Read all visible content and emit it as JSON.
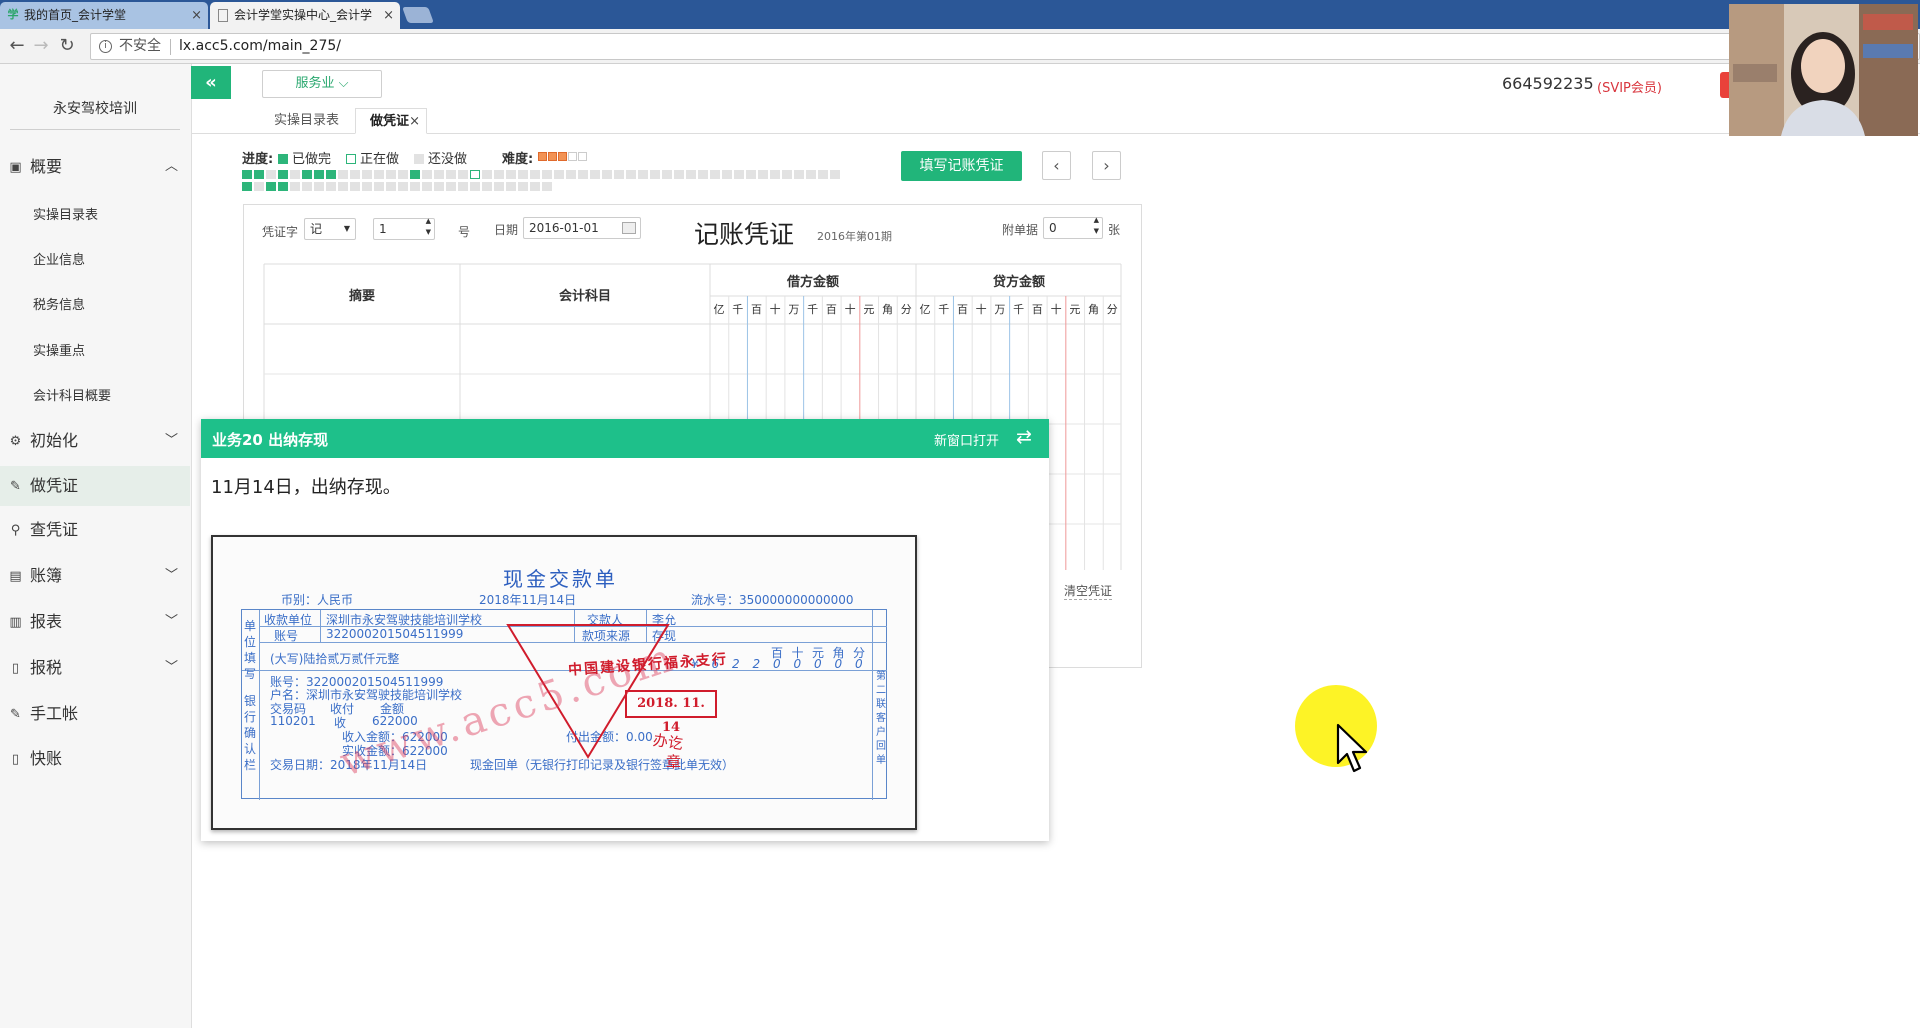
{
  "browser": {
    "tabs": [
      {
        "label": "我的首页_会计学堂",
        "close": "×"
      },
      {
        "label": "会计学堂实操中心_会计学",
        "close": "×"
      }
    ],
    "insecure_label": "不安全",
    "url": "lx.acc5.com/main_275/"
  },
  "sidebar": {
    "brand": "永安驾校培训",
    "menu": [
      {
        "label": "概要",
        "icon": "overview-icon",
        "expanded": true
      },
      {
        "label": "初始化",
        "icon": "gear-icon",
        "expanded": false
      },
      {
        "label": "做凭证",
        "icon": "pen-icon",
        "active": true
      },
      {
        "label": "查凭证",
        "icon": "search-icon"
      },
      {
        "label": "账簿",
        "icon": "book-icon",
        "expanded": false
      },
      {
        "label": "报表",
        "icon": "report-icon",
        "expanded": false
      },
      {
        "label": "报税",
        "icon": "document-icon",
        "expanded": false
      },
      {
        "label": "手工帐",
        "icon": "pen-icon"
      },
      {
        "label": "快账",
        "icon": "document-icon"
      }
    ],
    "overview_sub": [
      "实操目录表",
      "企业信息",
      "税务信息",
      "实操重点",
      "会计科目概要"
    ]
  },
  "header": {
    "collapse_icon": "«",
    "industry": "服务业",
    "user_id": "664592235",
    "membership": "(SVIP会员)",
    "page_tabs": [
      {
        "label": "实操目录表"
      },
      {
        "label": "做凭证",
        "active": true,
        "close": "×"
      }
    ]
  },
  "progress": {
    "label": "进度:",
    "legend_done": "已做完",
    "legend_doing": "正在做",
    "legend_todo": "还没做",
    "difficulty_label": "难度:",
    "difficulty": 3,
    "difficulty_max": 5,
    "colors": {
      "done": "#2db57a",
      "doing_border": "#2db57a",
      "todo": "#e2e2e2"
    },
    "row1": [
      "done",
      "done",
      "todo",
      "done",
      "todo",
      "done",
      "done",
      "done",
      "todo",
      "todo",
      "todo",
      "todo",
      "todo",
      "todo",
      "done",
      "todo",
      "todo",
      "todo",
      "todo",
      "doing",
      "todo",
      "todo",
      "todo",
      "todo",
      "todo",
      "todo",
      "todo",
      "todo",
      "todo",
      "todo",
      "todo",
      "todo",
      "todo",
      "todo",
      "todo",
      "todo",
      "todo",
      "todo",
      "todo",
      "todo",
      "todo",
      "todo",
      "todo",
      "todo",
      "todo",
      "todo",
      "todo",
      "todo",
      "todo",
      "todo"
    ],
    "row2": [
      "done",
      "todo",
      "done",
      "done",
      "todo",
      "todo",
      "todo",
      "todo",
      "todo",
      "todo",
      "todo",
      "todo",
      "todo",
      "todo",
      "todo",
      "todo",
      "todo",
      "todo",
      "todo",
      "todo",
      "todo",
      "todo",
      "todo",
      "todo",
      "todo",
      "todo"
    ]
  },
  "actions": {
    "fill_voucher": "填写记账凭证",
    "prev": "‹",
    "next": "›"
  },
  "voucher": {
    "word_label": "凭证字",
    "word_value": "记",
    "number": "1",
    "number_suffix": "号",
    "date_label": "日期",
    "date": "2016-01-01",
    "title": "记账凭证",
    "period": "2016年第01期",
    "attachments_label": "附单据",
    "attachments": "0",
    "attachments_suffix": "张",
    "col_summary": "摘要",
    "col_account": "会计科目",
    "col_debit": "借方金额",
    "col_credit": "贷方金额",
    "digits": [
      "亿",
      "千",
      "百",
      "十",
      "万",
      "千",
      "百",
      "十",
      "元",
      "角",
      "分"
    ],
    "clear": "清空凭证"
  },
  "task": {
    "title": "业务20 出纳存现",
    "open_new": "新窗口打开",
    "swap_icon": "⇄",
    "description": "11月14日，出纳存现。"
  },
  "receipt": {
    "title": "现金交款单",
    "currency": "币别：人民币",
    "date": "2018年11月14日",
    "serial": "流水号：350000000000000",
    "side_left": "单位填写",
    "side_bank": "银行确认栏",
    "side_right": "第二联客户回单",
    "payee_unit_label": "收款单位",
    "payee_unit": "深圳市永安驾驶技能培训学校",
    "payer_label": "交款人",
    "payer": "李允",
    "account_label": "账号",
    "account": "322000201504511999",
    "source_label": "款项来源",
    "source": "存现",
    "amount_words": "(大写)陆拾贰万贰仟元整",
    "amount_units": [
      "百",
      "十",
      "元",
      "角",
      "分"
    ],
    "amount_digits": [
      "¥",
      "6",
      "2",
      "2",
      "0",
      "0",
      "0",
      "0",
      "0"
    ],
    "bank_account": "账号：322000201504511999",
    "bank_name": "户名：深圳市永安驾驶技能培训学校",
    "txn_code_label": "交易码",
    "txn_code": "110201",
    "income_label": "收付",
    "income_type": "收",
    "amount_label": "金额",
    "amount": "622000",
    "received": "收入金额：622000",
    "actual": "实收金额：622000",
    "paid": "付出金额：0.00",
    "txn_date": "交易日期：2018年11月14日",
    "footer": "现金回单（无银行打印记录及银行签章此单无效）",
    "stamp_bank": "中国建设银行福永支行",
    "stamp_date": "2018. 11. 14",
    "stamp_ban": "办讫",
    "stamp_zhang": "章",
    "watermark": "www.acc5.com"
  }
}
